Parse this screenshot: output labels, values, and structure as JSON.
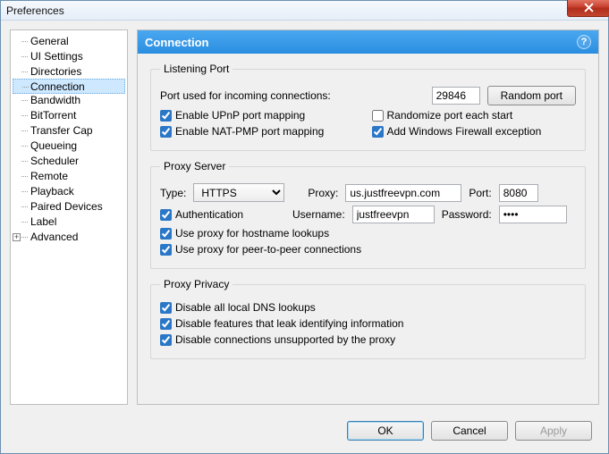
{
  "window": {
    "title": "Preferences"
  },
  "tree": {
    "items": [
      "General",
      "UI Settings",
      "Directories",
      "Connection",
      "Bandwidth",
      "BitTorrent",
      "Transfer Cap",
      "Queueing",
      "Scheduler",
      "Remote",
      "Playback",
      "Paired Devices",
      "Label",
      "Advanced"
    ],
    "selected": "Connection",
    "expandable": "Advanced"
  },
  "panel": {
    "title": "Connection"
  },
  "listening": {
    "legend": "Listening Port",
    "port_label": "Port used for incoming connections:",
    "port_value": "29846",
    "random_btn": "Random port",
    "cb_upnp": "Enable UPnP port mapping",
    "cb_randomize": "Randomize port each start",
    "cb_natpmp": "Enable NAT-PMP port mapping",
    "cb_firewall": "Add Windows Firewall exception"
  },
  "proxy": {
    "legend": "Proxy Server",
    "type_label": "Type:",
    "type_value": "HTTPS",
    "proxy_label": "Proxy:",
    "proxy_value": "us.justfreevpn.com",
    "port_label": "Port:",
    "port_value": "8080",
    "cb_auth": "Authentication",
    "user_label": "Username:",
    "user_value": "justfreevpn",
    "pass_label": "Password:",
    "pass_value": "••••",
    "cb_hostname": "Use proxy for hostname lookups",
    "cb_p2p": "Use proxy for peer-to-peer connections"
  },
  "privacy": {
    "legend": "Proxy Privacy",
    "cb_dns": "Disable all local DNS lookups",
    "cb_leak": "Disable features that leak identifying information",
    "cb_unsupported": "Disable connections unsupported by the proxy"
  },
  "buttons": {
    "ok": "OK",
    "cancel": "Cancel",
    "apply": "Apply"
  }
}
